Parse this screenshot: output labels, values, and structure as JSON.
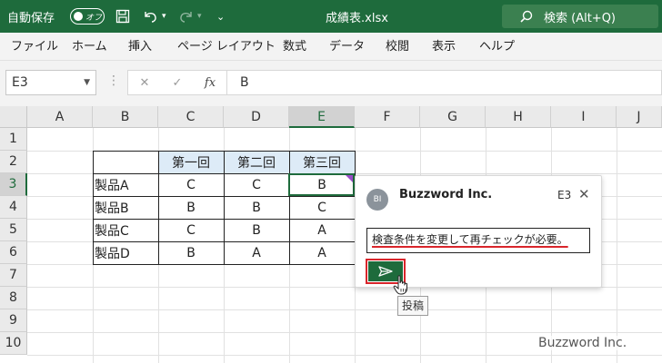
{
  "titlebar": {
    "autosave_label": "自動保存",
    "autosave_state": "オフ",
    "filename": "成績表.xlsx",
    "search_placeholder": "検索 (Alt+Q)"
  },
  "menu": [
    "ファイル",
    "ホーム",
    "挿入",
    "ページ レイアウト",
    "数式",
    "データ",
    "校閲",
    "表示",
    "ヘルプ"
  ],
  "formula_bar": {
    "namebox": "E3",
    "content": "B"
  },
  "columns": [
    "A",
    "B",
    "C",
    "D",
    "E",
    "F",
    "G",
    "H",
    "I",
    "J"
  ],
  "rows": [
    "1",
    "2",
    "3",
    "4",
    "5",
    "6",
    "7",
    "8",
    "9",
    "10"
  ],
  "table": {
    "headers": [
      "第一回",
      "第二回",
      "第三回"
    ],
    "rows": [
      {
        "product": "製品A",
        "values": [
          "C",
          "C",
          "B"
        ]
      },
      {
        "product": "製品B",
        "values": [
          "B",
          "B",
          "C"
        ]
      },
      {
        "product": "製品C",
        "values": [
          "C",
          "B",
          "A"
        ]
      },
      {
        "product": "製品D",
        "values": [
          "B",
          "A",
          "A"
        ]
      }
    ]
  },
  "comment": {
    "avatar_initials": "BI",
    "author": "Buzzword Inc.",
    "cell_ref": "E3",
    "draft_text": "検査条件を変更して再チェックが必要。",
    "send_tooltip": "投稿"
  },
  "watermark": "Buzzword Inc.",
  "colors": {
    "excel_green": "#1e6b3c",
    "header_fill": "#ddebf7",
    "highlight_red": "#d9252b"
  }
}
